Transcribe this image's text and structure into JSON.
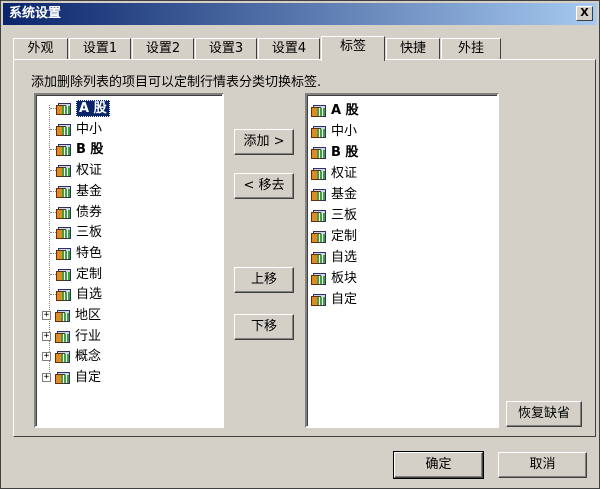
{
  "window": {
    "title": "系统设置",
    "close_label": "X"
  },
  "tabs": [
    {
      "label": "外观"
    },
    {
      "label": "设置1"
    },
    {
      "label": "设置2"
    },
    {
      "label": "设置3"
    },
    {
      "label": "设置4"
    },
    {
      "label": "标签",
      "active": true
    },
    {
      "label": "快捷"
    },
    {
      "label": "外挂"
    }
  ],
  "hint": "添加删除列表的项目可以定制行情表分类切换标签.",
  "left_tree": [
    {
      "label": "A 股",
      "bold": true,
      "selected": true
    },
    {
      "label": "中小"
    },
    {
      "label": "B 股",
      "bold": true
    },
    {
      "label": "权证"
    },
    {
      "label": "基金"
    },
    {
      "label": "债券"
    },
    {
      "label": "三板"
    },
    {
      "label": "特色"
    },
    {
      "label": "定制"
    },
    {
      "label": "自选"
    },
    {
      "label": "地区",
      "expandable": true
    },
    {
      "label": "行业",
      "expandable": true
    },
    {
      "label": "概念",
      "expandable": true
    },
    {
      "label": "自定",
      "expandable": true
    }
  ],
  "right_list": [
    {
      "label": "A 股",
      "bold": true
    },
    {
      "label": "中小"
    },
    {
      "label": "B 股",
      "bold": true
    },
    {
      "label": "权证"
    },
    {
      "label": "基金"
    },
    {
      "label": "三板"
    },
    {
      "label": "定制"
    },
    {
      "label": "自选"
    },
    {
      "label": "板块"
    },
    {
      "label": "自定"
    }
  ],
  "buttons": {
    "add": "添加 >",
    "remove": "< 移去",
    "move_up": "上移",
    "move_down": "下移",
    "restore": "恢复缺省",
    "ok": "确定",
    "cancel": "取消"
  },
  "expander_symbol": "+"
}
